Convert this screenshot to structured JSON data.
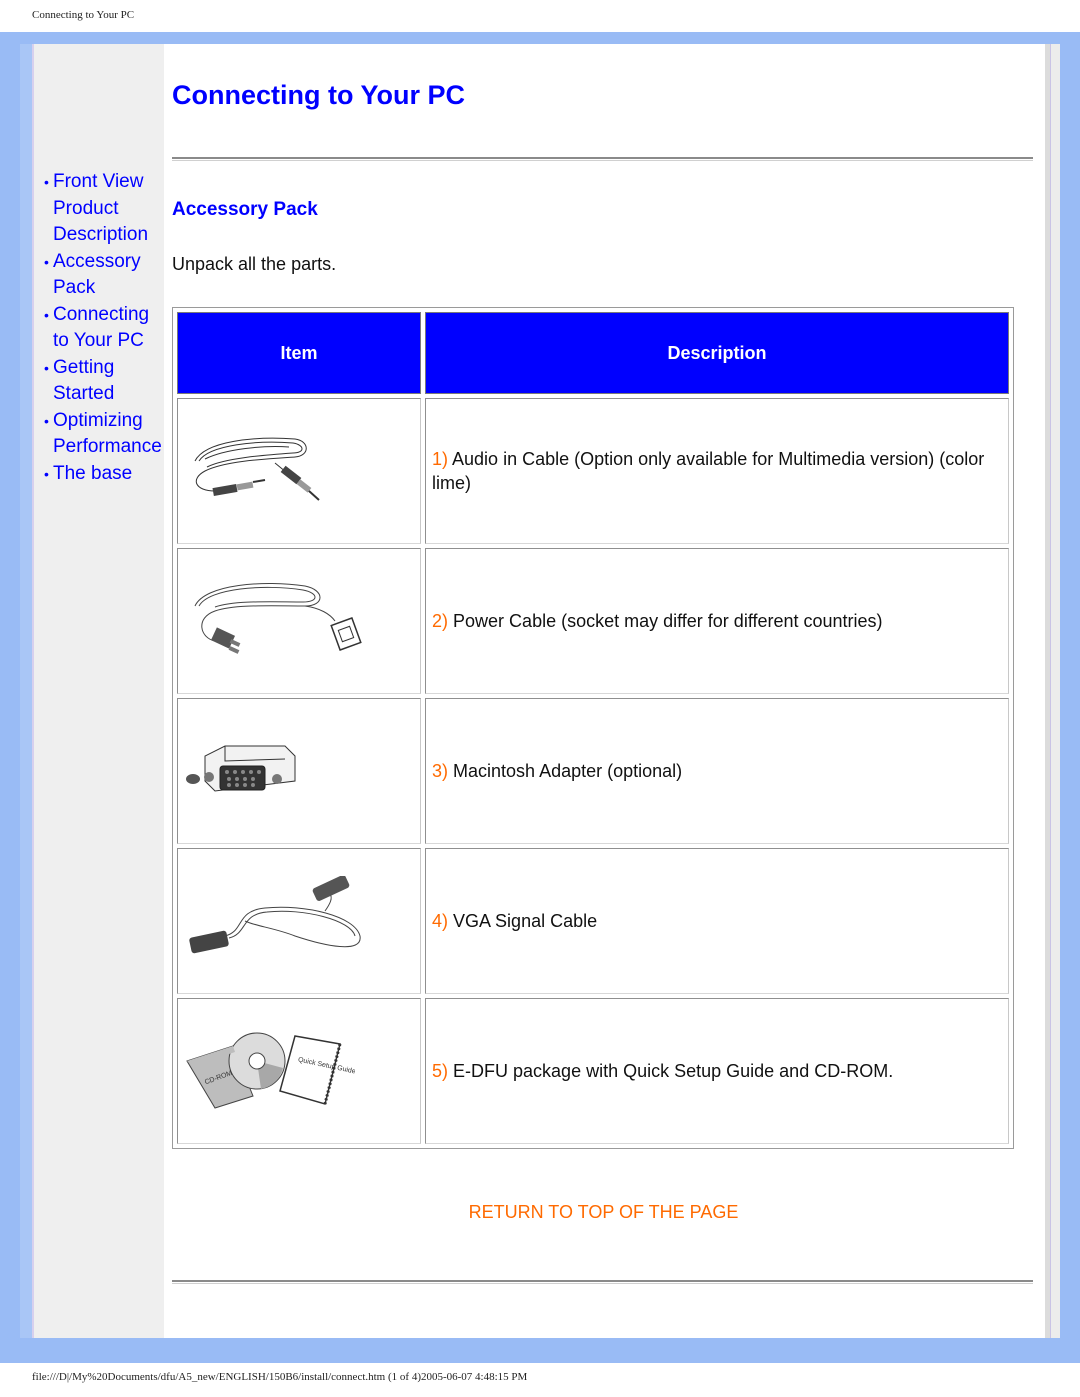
{
  "print_header": "Connecting to Your PC",
  "print_footer": "file:///D|/My%20Documents/dfu/A5_new/ENGLISH/150B6/install/connect.htm (1 of 4)2005-06-07 4:48:15 PM",
  "sidebar": {
    "items": [
      {
        "label": "Front View Product Description"
      },
      {
        "label": "Accessory Pack"
      },
      {
        "label": "Connecting to Your PC"
      },
      {
        "label": "Getting Started"
      },
      {
        "label": "Optimizing Performance"
      },
      {
        "label": "The base"
      }
    ]
  },
  "main": {
    "title": "Connecting to Your PC",
    "section_title": "Accessory Pack",
    "intro": "Unpack all the parts.",
    "table": {
      "headers": [
        "Item",
        "Description"
      ],
      "rows": [
        {
          "num": "1)",
          "icon": "audio-cable-icon",
          "text": "Audio in Cable (Option only available for Multimedia version) (color lime)"
        },
        {
          "num": "2)",
          "icon": "power-cable-icon",
          "text": "Power Cable (socket may differ for different countries)"
        },
        {
          "num": "3)",
          "icon": "mac-adapter-icon",
          "text": "Macintosh Adapter (optional)"
        },
        {
          "num": "4)",
          "icon": "vga-cable-icon",
          "text": "VGA Signal Cable"
        },
        {
          "num": "5)",
          "icon": "cd-rom-guide-icon",
          "text": "E-DFU package with Quick Setup Guide and CD-ROM."
        }
      ]
    },
    "return_link": "RETURN TO TOP OF THE PAGE",
    "cd_label": "CD-ROM",
    "guide_label": "Quick Setup Guide"
  },
  "colors": {
    "link": "#0000ff",
    "accent_orange": "#ff6a00",
    "frame_blue": "#99bbf5",
    "sidebar_bg": "#efefef",
    "header_bg": "#0000ff"
  }
}
